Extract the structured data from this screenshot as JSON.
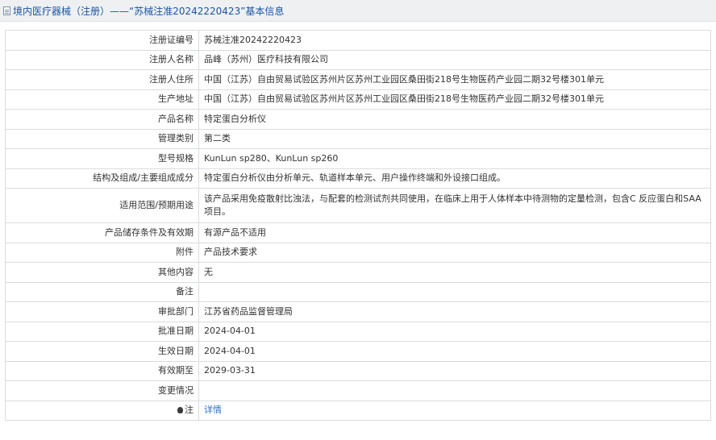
{
  "header": {
    "title": "境内医疗器械（注册）——“苏械注准20242220423”基本信息"
  },
  "rows": [
    {
      "label": "注册证编号",
      "value": "苏械注准20242220423"
    },
    {
      "label": "注册人名称",
      "value": "品峰（苏州）医疗科技有限公司"
    },
    {
      "label": "注册人住所",
      "value": "中国（江苏）自由贸易试验区苏州片区苏州工业园区桑田街218号生物医药产业园二期32号楼301单元"
    },
    {
      "label": "生产地址",
      "value": "中国（江苏）自由贸易试验区苏州片区苏州工业园区桑田街218号生物医药产业园二期32号楼301单元"
    },
    {
      "label": "产品名称",
      "value": "特定蛋白分析仪"
    },
    {
      "label": "管理类别",
      "value": "第二类"
    },
    {
      "label": "型号规格",
      "value": "KunLun sp280、KunLun sp260"
    },
    {
      "label": "结构及组成/主要组成成分",
      "value": "特定蛋白分析仪由分析单元、轨道样本单元、用户操作终端和外设接口组成。"
    },
    {
      "label": "适用范围/预期用途",
      "value": "该产品采用免疫散射比浊法，与配套的检测试剂共同使用，在临床上用于人体样本中待测物的定量检测，包含C 反应蛋白和SAA 项目。"
    },
    {
      "label": "产品储存条件及有效期",
      "value": "有源产品不适用"
    },
    {
      "label": "附件",
      "value": "产品技术要求"
    },
    {
      "label": "其他内容",
      "value": "无"
    },
    {
      "label": "备注",
      "value": ""
    },
    {
      "label": "审批部门",
      "value": "江苏省药品监督管理局"
    },
    {
      "label": "批准日期",
      "value": "2024-04-01"
    },
    {
      "label": "生效日期",
      "value": "2024-04-01"
    },
    {
      "label": "有效期至",
      "value": "2029-03-31"
    },
    {
      "label": "变更情况",
      "value": ""
    }
  ],
  "note": {
    "label": "注",
    "link_text": "详情",
    "icon": "bulb-icon"
  }
}
